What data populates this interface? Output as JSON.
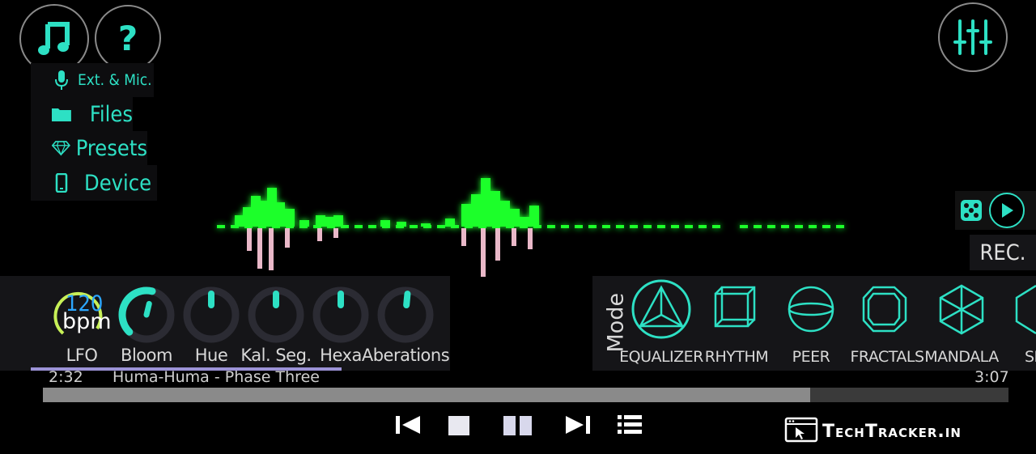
{
  "menu": {
    "items": [
      {
        "label": "Ext. & Mic.",
        "icon": "microphone-icon"
      },
      {
        "label": "Files",
        "icon": "folder-icon"
      },
      {
        "label": "Presets",
        "icon": "diamond-icon"
      },
      {
        "label": "Device",
        "icon": "phone-icon"
      }
    ]
  },
  "lfo": {
    "bpm_value": "120",
    "bpm_unit": "bpm"
  },
  "knobs": [
    {
      "label": "LFO"
    },
    {
      "label": "Bloom",
      "level": 0.55
    },
    {
      "label": "Hue",
      "level": 0.5
    },
    {
      "label": "Kal. Seg.",
      "level": 0.5
    },
    {
      "label": "Hexa",
      "level": 0.5
    },
    {
      "label": "Aberations",
      "level": 0.52
    }
  ],
  "mode": {
    "title": "Mode",
    "items": [
      {
        "label": "EQUALIZER",
        "icon": "triangle-pyramid-icon",
        "selected": true
      },
      {
        "label": "RHYTHM",
        "icon": "cube-icon",
        "selected": false
      },
      {
        "label": "PEER",
        "icon": "sphere-icon",
        "selected": false
      },
      {
        "label": "FRACTALS",
        "icon": "hexagonal-prism-icon",
        "selected": false
      },
      {
        "label": "MANDALA",
        "icon": "hexagon-wireframe-icon",
        "selected": false
      },
      {
        "label": "SHA",
        "icon": "shape-icon",
        "selected": false
      }
    ]
  },
  "rec": {
    "label": "REC."
  },
  "track": {
    "elapsed": "2:32",
    "title": "Huma-Huma - Phase Three",
    "duration": "3:07",
    "progress": 0.795
  },
  "watermark": {
    "text": "TechTracker.in"
  },
  "colors": {
    "accent": "#2de0c4",
    "wave_green": "#1aff2a",
    "panel": "#151518"
  }
}
